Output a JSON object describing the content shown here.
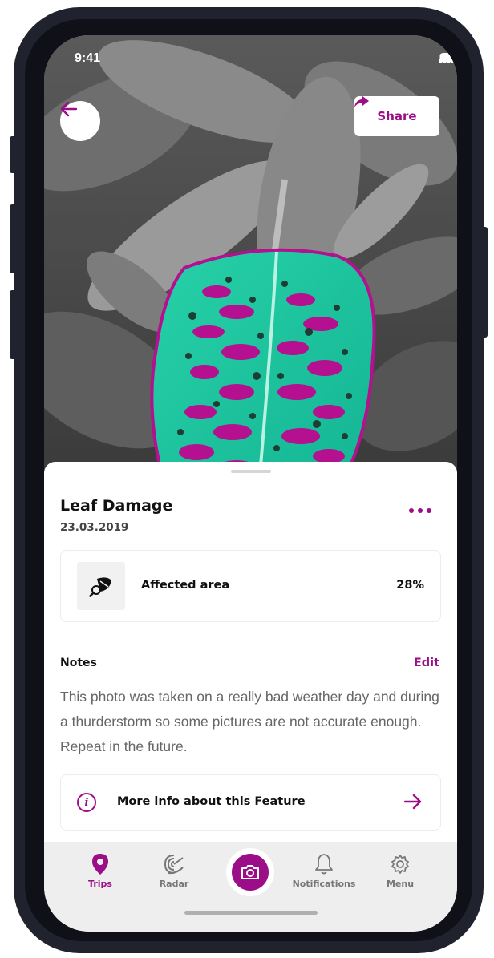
{
  "status_bar": {
    "time": "9:41"
  },
  "header": {
    "share_label": "Share"
  },
  "detail": {
    "title": "Leaf Damage",
    "date": "23.03.2019",
    "affected_area": {
      "label": "Affected area",
      "value": "28%"
    },
    "notes": {
      "title": "Notes",
      "edit_label": "Edit",
      "text": "This photo was taken on a really bad weather day and during a thurderstorm so some pictures are not accurate enough. Repeat in the future."
    },
    "more_info_label": "More info about this Feature"
  },
  "tabbar": {
    "items": [
      {
        "label": "Trips",
        "icon": "location-pin-icon",
        "active": true
      },
      {
        "label": "Radar",
        "icon": "radar-icon",
        "active": false
      },
      {
        "label": "Notifications",
        "icon": "bell-icon",
        "active": false
      },
      {
        "label": "Menu",
        "icon": "gear-icon",
        "active": false
      }
    ],
    "camera_icon": "camera-icon"
  },
  "colors": {
    "accent": "#9b0e87",
    "leaf_highlight": "#1fc6a0",
    "damage": "#b4108f",
    "tabbar_bg": "#eeeeee"
  }
}
